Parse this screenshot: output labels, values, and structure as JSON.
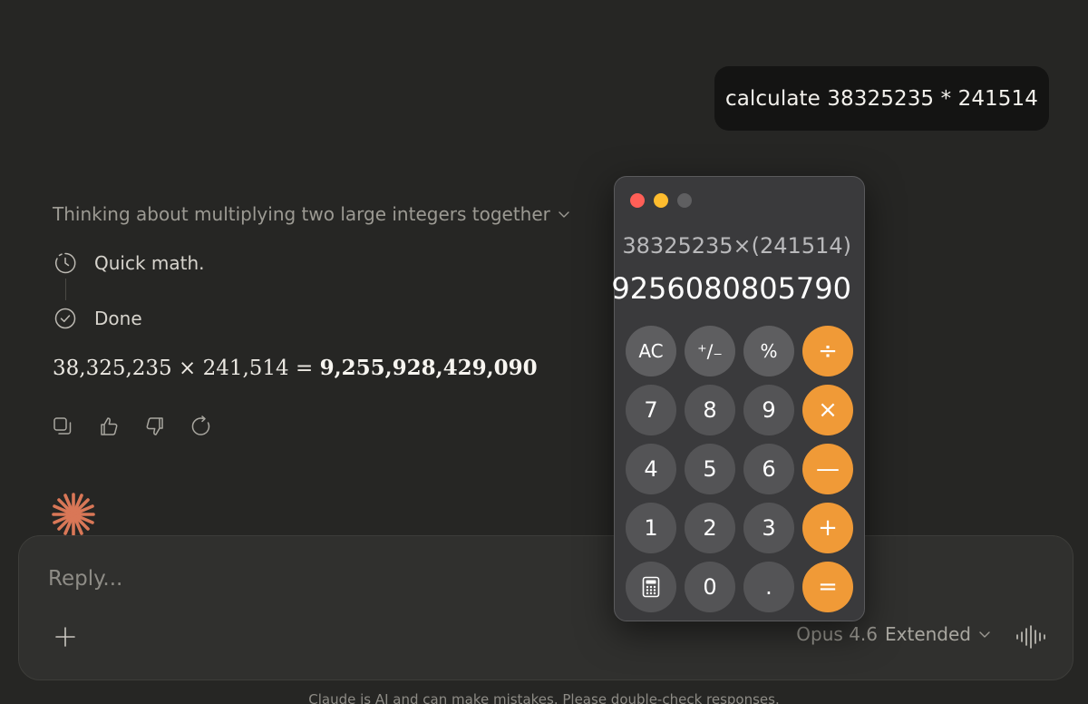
{
  "user_message": "calculate 38325235 * 241514",
  "thinking": {
    "summary": "Thinking about multiplying two large integers together",
    "steps": [
      "Quick math.",
      "Done"
    ]
  },
  "answer": {
    "expression": "38,325,235 × 241,514 = ",
    "result": "9,255,928,429,090"
  },
  "reply": {
    "placeholder": "Reply...",
    "model": "Opus 4.6",
    "mode": "Extended"
  },
  "disclaimer": "Claude is AI and can make mistakes. Please double-check responses.",
  "calculator": {
    "expression": "38325235×(241514)",
    "result": "9256080805790",
    "keys": {
      "ac": "AC",
      "sign": "⁺∕₋",
      "percent": "%",
      "divide": "÷",
      "k7": "7",
      "k8": "8",
      "k9": "9",
      "multiply": "×",
      "k4": "4",
      "k5": "5",
      "k6": "6",
      "minus": "—",
      "k1": "1",
      "k2": "2",
      "k3": "3",
      "plus": "+",
      "k0": "0",
      "dot": ".",
      "equals": "="
    }
  },
  "colors": {
    "background": "#262624",
    "accent_orange": "#f09a37",
    "claude_spark": "#d97757",
    "close": "#ff5f57",
    "minimize": "#febc2e",
    "zoom_inactive": "#5f5f61"
  },
  "icons": [
    "clock-icon",
    "check-circle-icon",
    "copy-icon",
    "thumbs-up-icon",
    "thumbs-down-icon",
    "retry-icon",
    "plus-icon",
    "chevron-down-icon",
    "voice-icon",
    "calculator-icon",
    "claude-spark-icon"
  ]
}
